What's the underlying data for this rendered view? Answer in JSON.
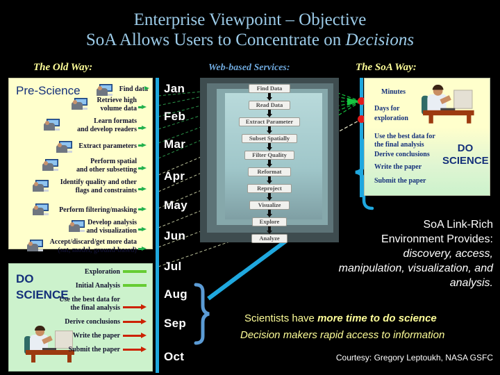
{
  "slide": {
    "title_line1": "Enterprise Viewpoint – Objective",
    "title_line2_a": "SoA Allows Users to Concentrate on ",
    "title_line2_b": "Decisions"
  },
  "headers": {
    "old_way": "The Old Way:",
    "web_services": "Web-based Services:",
    "soa_way": "The SoA Way:"
  },
  "old_way_panel": {
    "heading": "Pre-Science",
    "steps": [
      "Find data",
      "Retrieve high\nvolume data",
      "Learn formats\nand develop readers",
      "Extract parameters",
      "Perform spatial\nand other subsetting",
      "Identify quality and other\nflags and constraints",
      "Perform filtering/masking",
      "Develop analysis\nand visualization",
      "Accept/discard/get more data\n(sat, model, ground-based)"
    ]
  },
  "do_science_panel": {
    "heading_line1": "DO",
    "heading_line2": "SCIENCE",
    "steps": [
      "Exploration",
      "Initial Analysis",
      "Use the best data for\nthe final analysis",
      "Derive conclusions",
      "Write the paper",
      "Submit the paper"
    ]
  },
  "timeline": {
    "months": [
      "Jan",
      "Feb",
      "Mar",
      "Apr",
      "May",
      "Jun",
      "Jul",
      "Aug",
      "Sep",
      "Oct"
    ]
  },
  "web_services": {
    "boxes": [
      "Find Data",
      "Read Data",
      "Extract Parameter",
      "Subset Spatially",
      "Filter Quality",
      "Reformat",
      "Reproject",
      "Visualize",
      "Explore",
      "Analyze"
    ]
  },
  "soa_panel": {
    "minutes": "Minutes",
    "days_line1": "Days for",
    "days_line2": "exploration",
    "steps": [
      "Use the best data for",
      "the final analysis",
      "Derive conclusions",
      "Write the paper",
      "Submit the paper"
    ],
    "do_science_line1": "DO",
    "do_science_line2": "SCIENCE"
  },
  "conclusions": {
    "link_rich_line1": "SoA Link-Rich",
    "link_rich_line2": "Environment Provides:",
    "link_rich_line3": "discovery, access,",
    "link_rich_line4": "manipulation, visualization, and",
    "link_rich_line5": "analysis.",
    "scientists_prefix": "Scientists have ",
    "scientists_emphasis": "more time to do science",
    "decision_makers": "Decision makers rapid access to information",
    "courtesy": "Courtesy: Gregory Leptoukh, NASA GSFC"
  },
  "colors": {
    "title": "#9CCBE8",
    "accent_yellow": "#FFFF99",
    "panel_yellow": "#FFFFCC",
    "panel_green": "#CCF2CC",
    "cyan": "#1FA8DF",
    "green_arrow": "#22B14C",
    "red_arrow": "#CC2200",
    "navy_text": "#14307A",
    "background": "#000000"
  }
}
